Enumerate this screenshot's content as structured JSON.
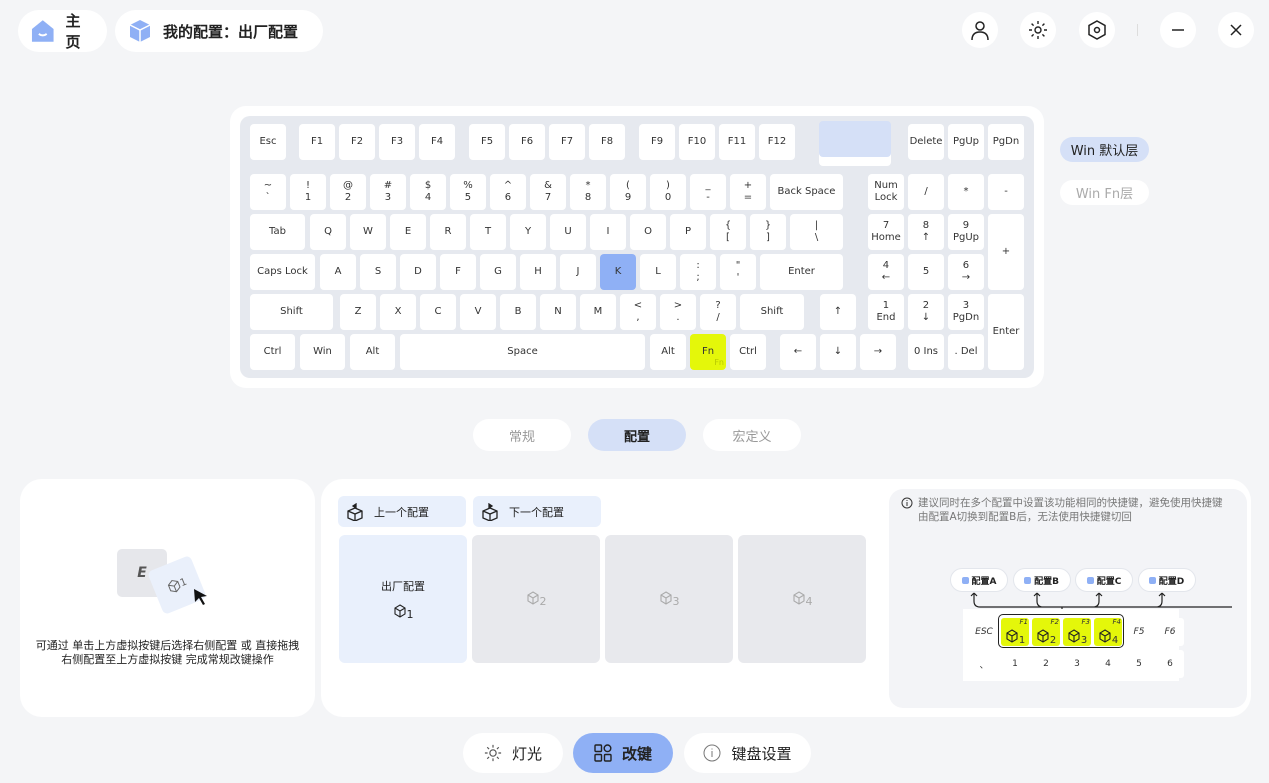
{
  "header": {
    "home_label": "主页",
    "config_label": "我的配置：出厂配置"
  },
  "toolbar": {
    "icons": [
      "user-icon",
      "brightness-icon",
      "settings-hex-icon",
      "minimize-icon",
      "close-icon"
    ]
  },
  "keyboard": {
    "rows": [
      [
        "Esc",
        "F1",
        "F2",
        "F3",
        "F4",
        "F5",
        "F6",
        "F7",
        "F8",
        "F9",
        "F10",
        "F11",
        "F12",
        "",
        "Delete",
        "PgUp",
        "PgDn"
      ],
      [
        "~\n`",
        "!\n1",
        "@\n2",
        "#\n3",
        "$\n4",
        "%\n5",
        "^\n6",
        "&\n7",
        "*\n8",
        "(\n9",
        ")\n0",
        "_\n-",
        "+\n=",
        "Back Space",
        "Num\nLock",
        "/",
        "*",
        "-"
      ],
      [
        "Tab",
        "Q",
        "W",
        "E",
        "R",
        "T",
        "Y",
        "U",
        "I",
        "O",
        "P",
        "{\n[",
        "}\n]",
        "|\n\\",
        "7\nHome",
        "8\n↑",
        "9\nPgUp",
        "+"
      ],
      [
        "Caps Lock",
        "A",
        "S",
        "D",
        "F",
        "G",
        "H",
        "J",
        "K",
        "L",
        ":\n;",
        "\"\n'",
        "Enter",
        "4\n←",
        "5",
        "6\n→"
      ],
      [
        "Shift",
        "Z",
        "X",
        "C",
        "V",
        "B",
        "N",
        "M",
        "<\n,",
        ">\n.",
        "?\n/",
        "Shift",
        "↑",
        "1\nEnd",
        "2\n↓",
        "3\nPgDn",
        "Enter"
      ],
      [
        "Ctrl",
        "Win",
        "Alt",
        "Space",
        "Alt",
        "Fn",
        "Ctrl",
        "←",
        "↓",
        "→",
        "0 Ins",
        ". Del"
      ]
    ],
    "selected_key": "K",
    "fn_sub": "Fn",
    "colors": {
      "selected": "#8fb0f5",
      "fn": "#e4f70a",
      "knob": "#d5e0f7"
    }
  },
  "layers": {
    "active": "Win 默认层",
    "inactive": "Win Fn层"
  },
  "tabs": {
    "items": [
      "常规",
      "配置",
      "宏定义"
    ],
    "active": 1
  },
  "left_panel": {
    "key_letter": "E",
    "drag_sub": "1",
    "hint_line1": "可通过 单击上方虚拟按键后选择右侧配置 或 直接拖拽",
    "hint_line2": "右侧配置至上方虚拟按键 完成常规改键操作"
  },
  "config_panel": {
    "prev": "上一个配置",
    "next": "下一个配置",
    "slots": [
      {
        "name": "出厂配置",
        "num": "1"
      },
      {
        "name": "",
        "num": "2"
      },
      {
        "name": "",
        "num": "3"
      },
      {
        "name": "",
        "num": "4"
      }
    ]
  },
  "tip_panel": {
    "tip_line1": "建议同时在多个配置中设置该功能相同的快捷键，避免使用快捷键",
    "tip_line2": "由配置A切换到配置B后，无法使用快捷键切回",
    "configs": [
      "配置A",
      "配置B",
      "配置C",
      "配置D"
    ],
    "row1": [
      "ESC",
      "1",
      "2",
      "3",
      "4",
      "F5",
      "F6"
    ],
    "fkeys": [
      "F1",
      "F2",
      "F3",
      "F4"
    ],
    "row2": [
      "、",
      "1",
      "2",
      "3",
      "4",
      "5",
      "6"
    ]
  },
  "bottom_nav": {
    "items": [
      "灯光",
      "改键",
      "键盘设置"
    ],
    "active": 1
  }
}
